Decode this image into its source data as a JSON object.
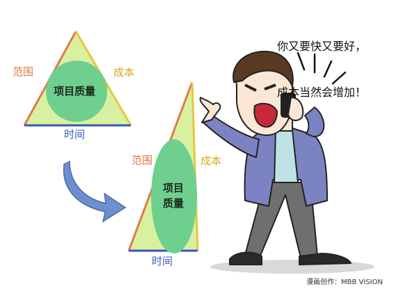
{
  "triangle_small": {
    "scope": "范围",
    "cost": "成本",
    "time": "时间",
    "quality": "项目质量"
  },
  "triangle_tall": {
    "scope": "范围",
    "cost": "成本",
    "time": "时间",
    "quality_line1": "项目",
    "quality_line2": "质量"
  },
  "speech": {
    "line1": "你又要快又要好，",
    "line2": "成本当然会增加！"
  },
  "credit": "漫画创作：MBB VISION",
  "colors": {
    "triangle_fill": "#d8f0a0",
    "ellipse_fill": "#6fcf8f",
    "scope_edge": "#e07a4a",
    "cost_edge": "#e9c63a",
    "time_edge": "#3a55b8",
    "arrow": "#6d8fd0",
    "jacket": "#7c83c3",
    "shirt": "#bfe3e5",
    "pants": "#6f6f6f"
  }
}
